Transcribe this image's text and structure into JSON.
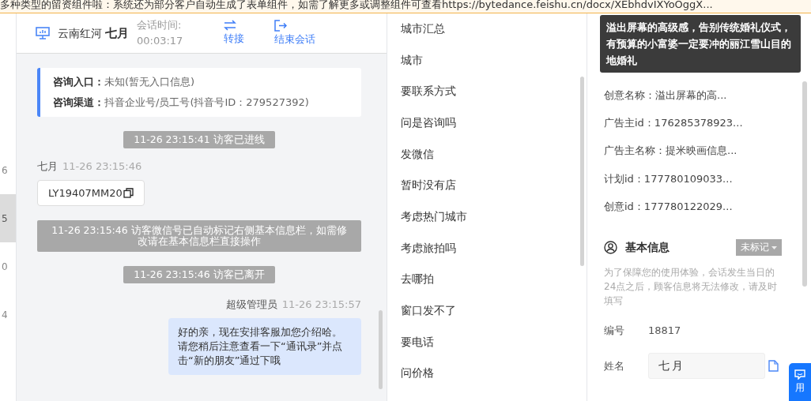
{
  "banner": {
    "text": "多种类型的留资组件啦：系统还为部分客户自动生成了表单组件，如需了解更多或调整组件可查看https://bytedance.feishu.cn/docx/XEbhdvIXYoOggX..."
  },
  "sidebar": {
    "items": [
      {
        "label": "6",
        "selected": false
      },
      {
        "label": "5",
        "selected": true
      },
      {
        "label": "0",
        "selected": false
      },
      {
        "label": "4",
        "selected": false
      }
    ]
  },
  "chat_header": {
    "source": "云南红河",
    "visitor": "七月",
    "time_label": "会话时间:",
    "time_value": "00:03:17",
    "actions": [
      {
        "kind": "transfer",
        "label": "转接"
      },
      {
        "kind": "end",
        "label": "结束会话"
      }
    ]
  },
  "inquiry": [
    {
      "label": "咨询入口：",
      "value": "未知(暂无入口信息)"
    },
    {
      "label": "咨询渠道：",
      "value": "抖音企业号/员工号(抖音号ID：279527392)"
    }
  ],
  "messages": [
    {
      "kind": "system",
      "text": "11-26 23:15:41 访客已进线"
    },
    {
      "kind": "visitor",
      "sender": "七月",
      "time": "11-26 23:15:46",
      "text": "LY19407MM20"
    },
    {
      "kind": "system",
      "text": "11-26 23:15:46 访客微信号已自动标记右侧基本信息栏，如需修改请在基本信息栏直接操作"
    },
    {
      "kind": "system",
      "text": "11-26 23:15:46 访客已离开"
    },
    {
      "kind": "agent",
      "sender": "超级管理员",
      "time": "11-26 23:15:57",
      "text": "好的亲，现在安排客服加您介绍哈。请您稍后注意查看一下“通讯录”并点击“新的朋友”通过下哦"
    }
  ],
  "quick_replies": [
    "城市汇总",
    "城市",
    "要联系方式",
    "问是咨询吗",
    "发微信",
    "暂时没有店",
    "考虑热门城市",
    "考虑旅拍吗",
    "去哪拍",
    "窗口发不了",
    "要电话",
    "问价格"
  ],
  "tooltip": {
    "text": "溢出屏幕的高级感，告别传统婚礼仪式，有预算的小富婆一定要冲的丽江雪山目的地婚礼"
  },
  "ad_info": [
    {
      "text": "创意名称：溢出屏幕的高..."
    },
    {
      "text": "广告主id：176285378923..."
    },
    {
      "text": "广告主名称：提米映画信息..."
    },
    {
      "text": "计划id：177780109033..."
    },
    {
      "text": "创意id：177780122029..."
    }
  ],
  "basic_info": {
    "title": "基本信息",
    "tag": "未标记",
    "notice": "为了保障您的使用体验，会话发生当日的24点之后，顾客信息将无法修改，请及时填写",
    "fields": [
      {
        "kind": "text",
        "label": "编号",
        "value": "18817"
      },
      {
        "kind": "input",
        "label": "姓名",
        "value": "七月"
      }
    ]
  },
  "float_button": {
    "label": "用"
  }
}
